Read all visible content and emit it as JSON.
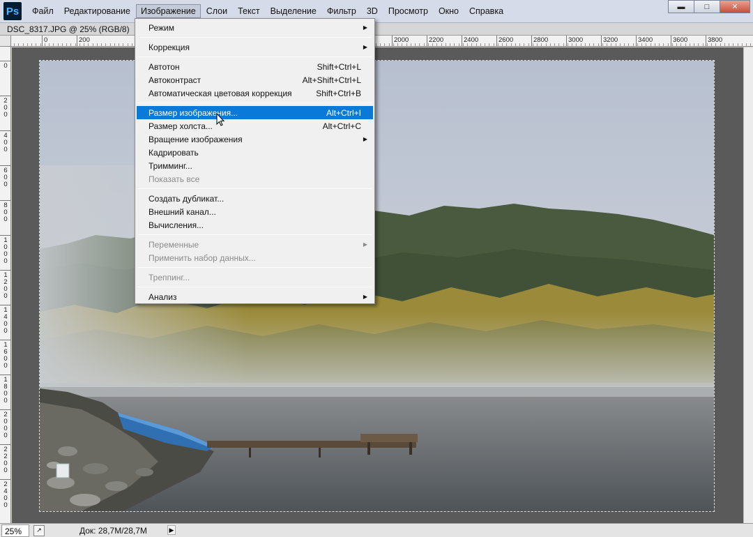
{
  "app": {
    "logo": "Ps"
  },
  "menubar": {
    "items": [
      "Файл",
      "Редактирование",
      "Изображение",
      "Слои",
      "Текст",
      "Выделение",
      "Фильтр",
      "3D",
      "Просмотр",
      "Окно",
      "Справка"
    ],
    "active": "Изображение"
  },
  "window_controls": {
    "minimize": "▬",
    "maximize": "□",
    "close": "✕"
  },
  "document": {
    "tab_title": "DSC_8317.JPG @ 25% (RGB/8)"
  },
  "ruler": {
    "top_labels": [
      "0",
      "200",
      "2000",
      "2200",
      "2400",
      "2600",
      "2800",
      "3000",
      "3200",
      "3400",
      "3600",
      "3800"
    ],
    "left_labels": [
      "0",
      "200",
      "400",
      "600",
      "800",
      "1000",
      "1200",
      "1400",
      "1600",
      "1800",
      "2000",
      "2200",
      "2400"
    ]
  },
  "image_menu": {
    "items": [
      {
        "label": "Режим",
        "shortcut": "",
        "submenu": true,
        "disabled": false
      },
      {
        "separator": true
      },
      {
        "label": "Коррекция",
        "shortcut": "",
        "submenu": true,
        "disabled": false
      },
      {
        "separator": true
      },
      {
        "label": "Автотон",
        "shortcut": "Shift+Ctrl+L",
        "submenu": false,
        "disabled": false
      },
      {
        "label": "Автоконтраст",
        "shortcut": "Alt+Shift+Ctrl+L",
        "submenu": false,
        "disabled": false
      },
      {
        "label": "Автоматическая цветовая коррекция",
        "shortcut": "Shift+Ctrl+B",
        "submenu": false,
        "disabled": false
      },
      {
        "separator": true
      },
      {
        "label": "Размер изображения...",
        "shortcut": "Alt+Ctrl+I",
        "submenu": false,
        "disabled": false,
        "highlighted": true
      },
      {
        "label": "Размер холста...",
        "shortcut": "Alt+Ctrl+C",
        "submenu": false,
        "disabled": false
      },
      {
        "label": "Вращение изображения",
        "shortcut": "",
        "submenu": true,
        "disabled": false
      },
      {
        "label": "Кадрировать",
        "shortcut": "",
        "submenu": false,
        "disabled": false
      },
      {
        "label": "Тримминг...",
        "shortcut": "",
        "submenu": false,
        "disabled": false
      },
      {
        "label": "Показать все",
        "shortcut": "",
        "submenu": false,
        "disabled": true
      },
      {
        "separator": true
      },
      {
        "label": "Создать дубликат...",
        "shortcut": "",
        "submenu": false,
        "disabled": false
      },
      {
        "label": "Внешний канал...",
        "shortcut": "",
        "submenu": false,
        "disabled": false
      },
      {
        "label": "Вычисления...",
        "shortcut": "",
        "submenu": false,
        "disabled": false
      },
      {
        "separator": true
      },
      {
        "label": "Переменные",
        "shortcut": "",
        "submenu": true,
        "disabled": true
      },
      {
        "label": "Применить набор данных...",
        "shortcut": "",
        "submenu": false,
        "disabled": true
      },
      {
        "separator": true
      },
      {
        "label": "Треппинг...",
        "shortcut": "",
        "submenu": false,
        "disabled": true
      },
      {
        "separator": true
      },
      {
        "label": "Анализ",
        "shortcut": "",
        "submenu": true,
        "disabled": false
      }
    ]
  },
  "statusbar": {
    "zoom": "25%",
    "doc_size": "Док: 28,7M/28,7M"
  },
  "colors": {
    "highlight": "#0a7ad8",
    "pasteboard": "#5a5a5a",
    "menubar": "#d6dbe9"
  }
}
